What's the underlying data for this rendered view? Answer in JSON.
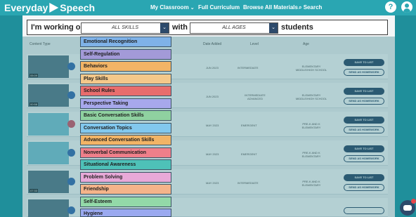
{
  "nav": {
    "brand_left": "Everyday",
    "brand_right": "Speech",
    "links": [
      "My Classroom",
      "Full Curriculum",
      "Browse All Materials",
      "Search"
    ],
    "help": "?"
  },
  "filter": {
    "prefix": "I'm working on",
    "skills_value": "ALL SKILLS",
    "with": "with",
    "ages_value": "ALL AGES",
    "suffix": "students"
  },
  "table": {
    "headers": [
      "Content Type",
      "Date Added",
      "Level",
      "Age"
    ],
    "rows": [
      {
        "duration": "05:09",
        "date": "JUN 2023",
        "level": "INTERMEDIATE",
        "age": "ELEMENTARY\nMIDDLE/HIGH SCHOOL",
        "save": "SAVE TO LIST",
        "send": "SEND AS HOMEWORK"
      },
      {
        "duration": "00:58",
        "date": "JUN 2023",
        "level": "INTERMEDIATE\nADVANCED",
        "age": "ELEMENTARY\nMIDDLE/HIGH SCHOOL",
        "save": "SAVE TO LIST",
        "send": "SEND AS HOMEWORK"
      },
      {
        "duration": "",
        "date": "MAY 2023",
        "level": "EMERGENT",
        "age": "PRE-K AND K\nELEMENTARY",
        "save": "SAVE TO LIST",
        "send": "SEND AS HOMEWORK"
      },
      {
        "duration": "",
        "date": "MAY 2023",
        "level": "EMERGENT",
        "age": "PRE-K AND K\nELEMENTARY",
        "save": "SAVE TO LIST",
        "send": "SEND AS HOMEWORK"
      },
      {
        "duration": "07:33",
        "date": "MAY 2023",
        "level": "INTERMEDIATE",
        "age": "PRE-K AND K\nELEMENTARY",
        "save": "SAVE TO LIST",
        "send": "SEND AS HOMEWORK"
      }
    ]
  },
  "dropdown": {
    "items": [
      {
        "label": "Emotional Recognition",
        "color": "#7fb2e8"
      },
      {
        "label": "Self-Regulation",
        "color": "#a39ad8"
      },
      {
        "label": "Behaviors",
        "color": "#f2b466"
      },
      {
        "label": "Play Skills",
        "color": "#f4c88a"
      },
      {
        "label": "School Rules",
        "color": "#e86d6d"
      },
      {
        "label": "Perspective Taking",
        "color": "#a7a8ec"
      },
      {
        "label": "Basic Conversation Skills",
        "color": "#8fd1a0"
      },
      {
        "label": "Conversation Topics",
        "color": "#82c8ee"
      },
      {
        "label": "Advanced Conversation Skills",
        "color": "#f2b466"
      },
      {
        "label": "Nonverbal Communication",
        "color": "#ef7f8a"
      },
      {
        "label": "Situational Awareness",
        "color": "#4ec1b8"
      },
      {
        "label": "Problem Solving",
        "color": "#e8a9d8"
      },
      {
        "label": "Friendship",
        "color": "#f4b48a"
      },
      {
        "label": "Self-Esteem",
        "color": "#93d9a8"
      },
      {
        "label": "Hygiene",
        "color": "#9aa9f0"
      }
    ]
  }
}
